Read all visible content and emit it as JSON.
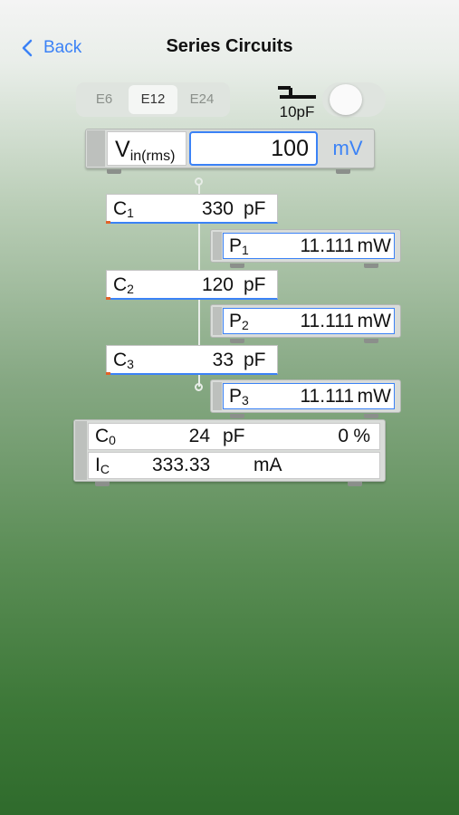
{
  "nav": {
    "back_label": "Back",
    "title": "Series Circuits"
  },
  "series_selector": {
    "options": [
      "E6",
      "E12",
      "E24"
    ],
    "selected": "E12"
  },
  "stray_capacitance": {
    "label": "10pF",
    "icon": "capacitor-symbol-icon",
    "enabled": false
  },
  "input": {
    "label": "V",
    "label_sub": "in(rms)",
    "value": "100",
    "unit": "mV"
  },
  "capacitors": [
    {
      "label": "C",
      "sub": "1",
      "value": "330",
      "unit": "pF"
    },
    {
      "label": "C",
      "sub": "2",
      "value": "120",
      "unit": "pF"
    },
    {
      "label": "C",
      "sub": "3",
      "value": "33",
      "unit": "pF"
    }
  ],
  "powers": [
    {
      "label": "P",
      "sub": "1",
      "value": "11.111",
      "unit": "mW"
    },
    {
      "label": "P",
      "sub": "2",
      "value": "11.111",
      "unit": "mW"
    },
    {
      "label": "P",
      "sub": "3",
      "value": "11.111",
      "unit": "mW"
    }
  ],
  "result": {
    "c0_label": "C",
    "c0_sub": "0",
    "c0_value": "24",
    "c0_unit": "pF",
    "error_value": "0",
    "error_unit": "%",
    "ic_label": "I",
    "ic_sub": "C",
    "ic_value": "333.33",
    "ic_unit": "mA"
  },
  "colors": {
    "accent": "#3b82f6",
    "marker": "#e0622a"
  }
}
